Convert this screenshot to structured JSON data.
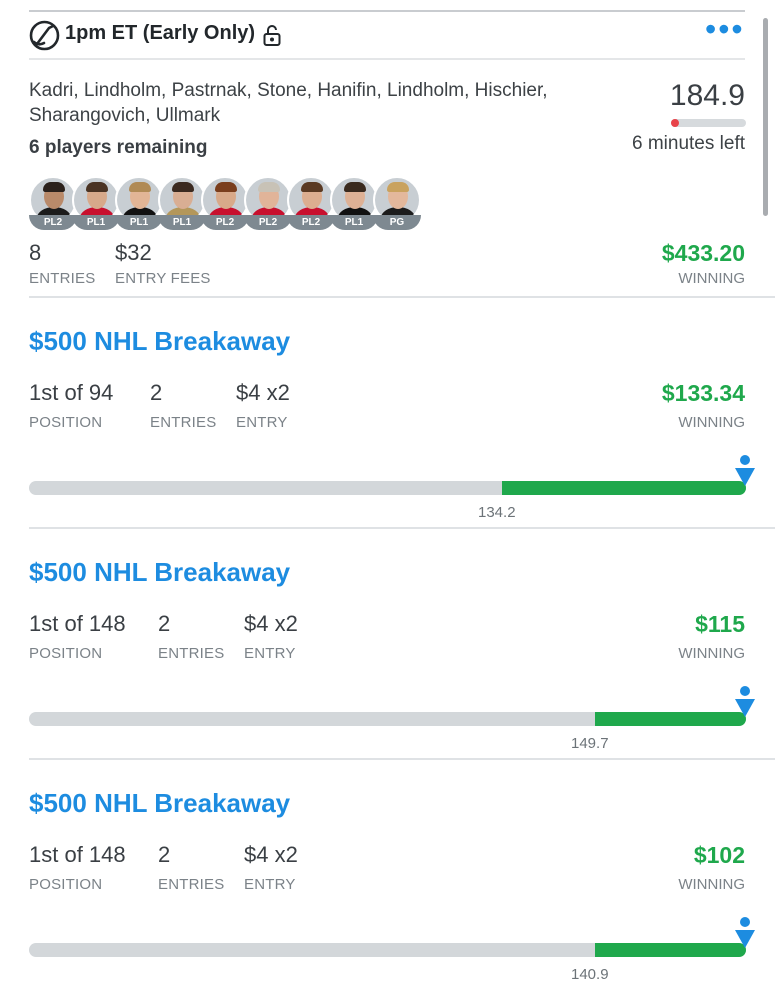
{
  "lineup": {
    "title": "1pm ET (Early Only)",
    "players": "Kadri, Lindholm, Pastrnak, Stone, Hanifin, Lindholm, Hischier, Sharangovich, Ullmark",
    "remaining": "6 players remaining",
    "score": "184.9",
    "time_left": "6 minutes left",
    "time_progress": 0.06,
    "avatars": [
      {
        "pos": "PL2",
        "skin": "#b98a6a",
        "hair": "#2b211c",
        "jersey": "#1c1c1c"
      },
      {
        "pos": "PL1",
        "skin": "#d7a98a",
        "hair": "#4a3323",
        "jersey": "#c8102e"
      },
      {
        "pos": "PL1",
        "skin": "#e2b596",
        "hair": "#b08a55",
        "jersey": "#111111"
      },
      {
        "pos": "PL1",
        "skin": "#d9ae93",
        "hair": "#3b2a20",
        "jersey": "#b4975a"
      },
      {
        "pos": "PL2",
        "skin": "#d8a989",
        "hair": "#7a3e1d",
        "jersey": "#c8102e"
      },
      {
        "pos": "PL2",
        "skin": "#e1b499",
        "hair": "#c8c2b6",
        "jersey": "#c8102e"
      },
      {
        "pos": "PL2",
        "skin": "#dcae90",
        "hair": "#5a3a23",
        "jersey": "#c8102e"
      },
      {
        "pos": "PL1",
        "skin": "#deb195",
        "hair": "#3a2a1e",
        "jersey": "#111111"
      },
      {
        "pos": "PG",
        "skin": "#e3b89c",
        "hair": "#c9a25e",
        "jersey": "#1c1c1c"
      }
    ],
    "entries": "8",
    "entries_label": "ENTRIES",
    "entry_fees": "$32",
    "entry_fees_label": "ENTRY FEES",
    "winning": "$433.20",
    "winning_label": "WINNING"
  },
  "contests": [
    {
      "name": "$500 NHL Breakaway",
      "position": "1st of 94",
      "position_label": "POSITION",
      "entries": "2",
      "entries_label": "ENTRIES",
      "entry": "$4 x2",
      "entry_label": "ENTRY",
      "winning": "$133.34",
      "winning_label": "WINNING",
      "cutoff": "134.2",
      "cutoff_fraction": 0.65
    },
    {
      "name": "$500 NHL Breakaway",
      "position": "1st of 148",
      "position_label": "POSITION",
      "entries": "2",
      "entries_label": "ENTRIES",
      "entry": "$4 x2",
      "entry_label": "ENTRY",
      "winning": "$115",
      "winning_label": "WINNING",
      "cutoff": "149.7",
      "cutoff_fraction": 0.78
    },
    {
      "name": "$500 NHL Breakaway",
      "position": "1st of 148",
      "position_label": "POSITION",
      "entries": "2",
      "entries_label": "ENTRIES",
      "entry": "$4 x2",
      "entry_label": "ENTRY",
      "winning": "$102",
      "winning_label": "WINNING",
      "cutoff": "140.9",
      "cutoff_fraction": 0.78
    }
  ],
  "colors": {
    "accent": "#1d8ce0",
    "money": "#1fa84c",
    "alert": "#e8434a"
  },
  "icons": {
    "lineup": "hockey-stick-icon",
    "lock": "unlock-icon",
    "more": "more-dots-icon",
    "user": "user-marker-icon"
  }
}
